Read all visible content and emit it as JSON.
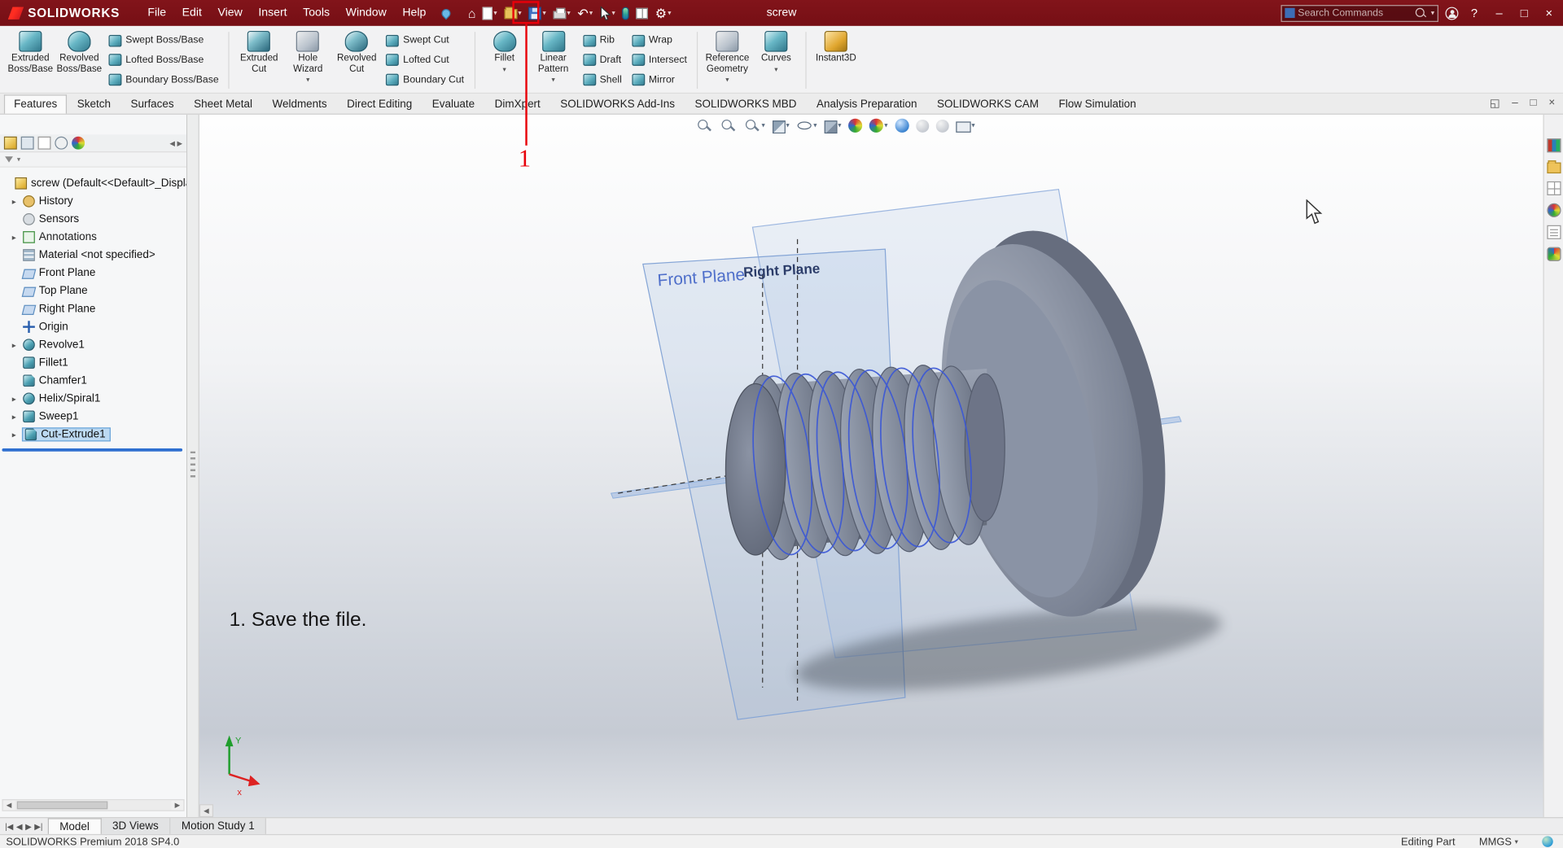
{
  "glyphs": {
    "caret": "▾",
    "tree_arrow": "▸",
    "left": "◀",
    "right": "▶",
    "first": "|◀",
    "last": "▶|",
    "minimize": "–",
    "restore": "□",
    "close": "×",
    "help": "?",
    "home": "⌂",
    "undo": "↶",
    "gear": "⚙",
    "panel_corner": "◱"
  },
  "titlebar": {
    "logo_text": "SOLIDWORKS",
    "menus": [
      "File",
      "Edit",
      "View",
      "Insert",
      "Tools",
      "Window",
      "Help"
    ],
    "document_title": "screw",
    "search_placeholder": "Search Commands"
  },
  "ribbon": {
    "extruded_boss": "Extruded Boss/Base",
    "revolved_boss": "Revolved Boss/Base",
    "swept_boss": "Swept Boss/Base",
    "lofted_boss": "Lofted Boss/Base",
    "boundary_boss": "Boundary Boss/Base",
    "extruded_cut": "Extruded Cut",
    "hole_wizard": "Hole Wizard",
    "revolved_cut": "Revolved Cut",
    "swept_cut": "Swept Cut",
    "lofted_cut": "Lofted Cut",
    "boundary_cut": "Boundary Cut",
    "fillet": "Fillet",
    "linear_pattern": "Linear Pattern",
    "rib": "Rib",
    "draft": "Draft",
    "shell": "Shell",
    "wrap": "Wrap",
    "intersect": "Intersect",
    "mirror": "Mirror",
    "reference_geometry": "Reference Geometry",
    "curves": "Curves",
    "instant3d": "Instant3D"
  },
  "tabs": [
    "Features",
    "Sketch",
    "Surfaces",
    "Sheet Metal",
    "Weldments",
    "Direct Editing",
    "Evaluate",
    "DimXpert",
    "SOLIDWORKS Add-Ins",
    "SOLIDWORKS MBD",
    "Analysis Preparation",
    "SOLIDWORKS CAM",
    "Flow Simulation"
  ],
  "active_tab": "Features",
  "tree": {
    "root": "screw (Default<<Default>_Display Sta",
    "items": [
      {
        "label": "History",
        "icon": "history"
      },
      {
        "label": "Sensors",
        "icon": "sensors"
      },
      {
        "label": "Annotations",
        "icon": "annotations"
      },
      {
        "label": "Material <not specified>",
        "icon": "material"
      },
      {
        "label": "Front Plane",
        "icon": "plane"
      },
      {
        "label": "Top Plane",
        "icon": "plane"
      },
      {
        "label": "Right Plane",
        "icon": "plane"
      },
      {
        "label": "Origin",
        "icon": "origin"
      },
      {
        "label": "Revolve1",
        "icon": "revolve-feature"
      },
      {
        "label": "Fillet1",
        "icon": "fillet-feature"
      },
      {
        "label": "Chamfer1",
        "icon": "chamfer-feature"
      },
      {
        "label": "Helix/Spiral1",
        "icon": "helix-curve"
      },
      {
        "label": "Sweep1",
        "icon": "sweep-feature"
      },
      {
        "label": "Cut-Extrude1",
        "icon": "cut-extrude-feature"
      }
    ],
    "selected_item": "Cut-Extrude1"
  },
  "viewport": {
    "front_plane_label": "Front Plane",
    "right_plane_label": "Right Plane",
    "instruction": "1. Save the file.",
    "triad_x": "x",
    "triad_y": "Y"
  },
  "annotation": {
    "step": "1"
  },
  "doc_tabs": [
    "Model",
    "3D Views",
    "Motion Study 1"
  ],
  "active_doc_tab": "Model",
  "statusbar": {
    "left": "SOLIDWORKS Premium 2018 SP4.0",
    "mode": "Editing Part",
    "units": "MMGS"
  },
  "colors": {
    "titlebar": "#7a1016",
    "accent_red": "#e8000a",
    "selection": "#bcd9f2",
    "helix_blue": "#3a57d6"
  },
  "icon_names": {
    "quick_access": [
      "home",
      "new-document",
      "open-document",
      "save",
      "print",
      "undo",
      "select-pointer",
      "rebuild",
      "display-options",
      "settings-gear"
    ],
    "heads_up": [
      "zoom-to-fit",
      "zoom-to-area",
      "previous-view",
      "section-view",
      "hide-show-items",
      "display-style",
      "edit-appearance",
      "apply-scene",
      "view-settings",
      "shadow-sphere",
      "perspective-sphere",
      "camera-view"
    ],
    "task_pane": [
      "design-library",
      "file-explorer",
      "view-palette",
      "appearances-scenes",
      "custom-properties"
    ],
    "manager_tabs": [
      "featuremanager-design-tree",
      "propertymanager",
      "configurationmanager",
      "dimxpertmanager",
      "displaymanager"
    ]
  }
}
